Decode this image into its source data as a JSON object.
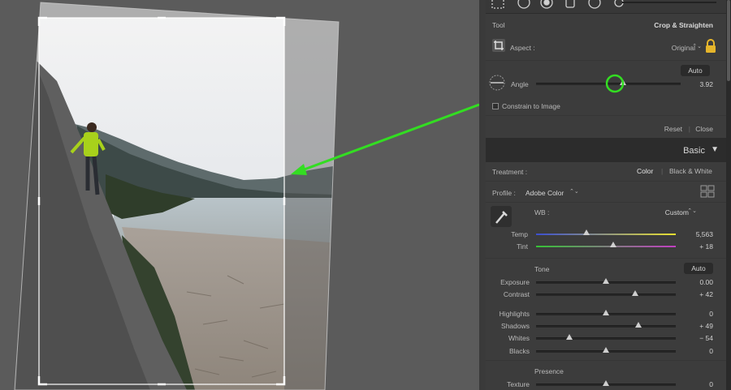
{
  "tool_panel": {
    "tool_label": "Tool",
    "tool_name": "Crop & Straighten",
    "aspect_label": "Aspect :",
    "aspect_value": "Original",
    "auto_label": "Auto",
    "angle_label": "Angle",
    "angle_value": "3.92",
    "angle_level": 0.6,
    "constrain_label": "Constrain to Image",
    "reset_label": "Reset",
    "close_label": "Close"
  },
  "basic": {
    "title": "Basic",
    "treatment_label": "Treatment :",
    "treatment_color": "Color",
    "treatment_bw": "Black & White",
    "profile_label": "Profile :",
    "profile_value": "Adobe Color",
    "wb_label": "WB :",
    "wb_value": "Custom",
    "tone_label": "Tone",
    "tone_auto": "Auto",
    "presence_label": "Presence",
    "sliders": {
      "temp": {
        "label": "Temp",
        "value": "5,563",
        "level": 0.36
      },
      "tint": {
        "label": "Tint",
        "value": "+ 18",
        "level": 0.55
      },
      "exposure": {
        "label": "Exposure",
        "value": "0.00",
        "level": 0.5
      },
      "contrast": {
        "label": "Contrast",
        "value": "+ 42",
        "level": 0.71
      },
      "highlights": {
        "label": "Highlights",
        "value": "0",
        "level": 0.5
      },
      "shadows": {
        "label": "Shadows",
        "value": "+ 49",
        "level": 0.73
      },
      "whites": {
        "label": "Whites",
        "value": "− 54",
        "level": 0.24
      },
      "blacks": {
        "label": "Blacks",
        "value": "0",
        "level": 0.5
      },
      "texture": {
        "label": "Texture",
        "value": "0",
        "level": 0.5
      }
    }
  },
  "colors": {
    "annotation_green": "#33dd22",
    "panel_bg": "#3c3c3c",
    "temp_gradient_start": "#3b4fd0",
    "temp_gradient_end": "#e8e030",
    "tint_gradient_start": "#36c236",
    "tint_gradient_end": "#c23fc2"
  }
}
